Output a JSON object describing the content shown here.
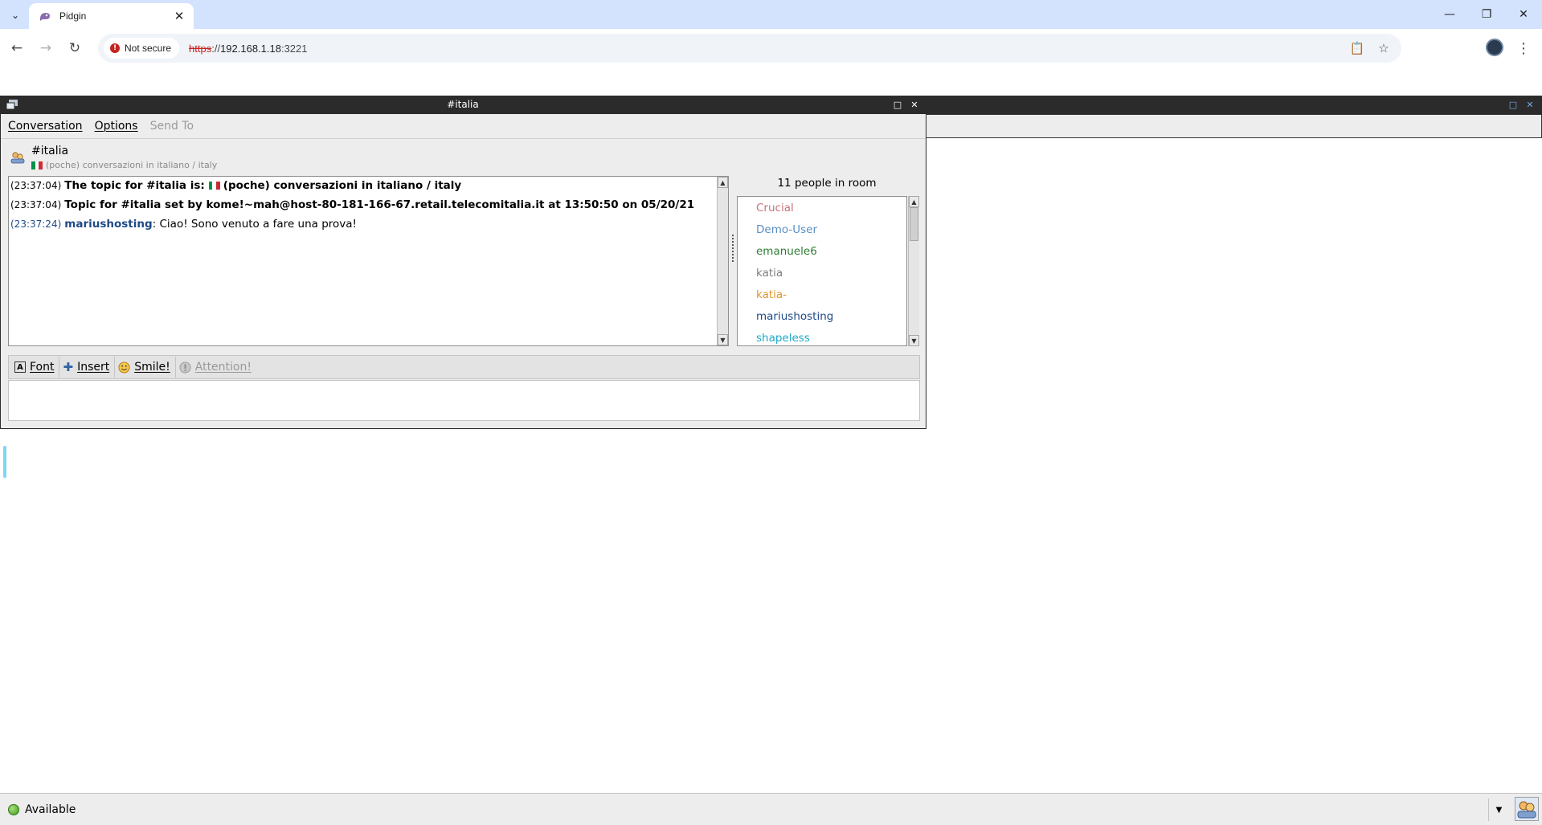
{
  "browser": {
    "tab_title": "Pidgin",
    "security_label": "Not secure",
    "url_scheme": "https",
    "url_separator": "://",
    "url_host": "192.168.1.18",
    "url_port": ":3221"
  },
  "window": {
    "title": "#italia"
  },
  "menu": {
    "conversation": "Conversation",
    "options": "Options",
    "send_to": "Send To"
  },
  "conversation": {
    "name": "#italia",
    "topic": "(poche) conversazioni in italiano / italy",
    "messages": [
      {
        "time": "(23:37:04)",
        "text": "The topic for #italia is:",
        "text2": "(poche) conversazioni in italiano / italy"
      },
      {
        "time": "(23:37:04)",
        "text": "Topic for #italia set by kome!~mah@host-80-181-166-67.retail.telecomitalia.it at 13:50:50 on 05/20/21"
      },
      {
        "time": "(23:37:24)",
        "nick": "mariushosting",
        "text": ": Ciao! Sono venuto a fare una prova!"
      }
    ]
  },
  "people": {
    "count_label": "11 people in room",
    "users": [
      {
        "name": "Crucial",
        "color": "#c8737a"
      },
      {
        "name": "Demo-User",
        "color": "#5b8fc4"
      },
      {
        "name": "emanuele6",
        "color": "#2e7d32"
      },
      {
        "name": "katia",
        "color": "#7d7d7d"
      },
      {
        "name": "katia-",
        "color": "#e0962c"
      },
      {
        "name": "mariushosting",
        "color": "#204a87"
      },
      {
        "name": "shapeless",
        "color": "#1ea7c9"
      }
    ]
  },
  "format_toolbar": {
    "font": "Font",
    "insert": "Insert",
    "smile": "Smile!",
    "attention": "Attention!"
  },
  "status": {
    "label": "Available"
  }
}
